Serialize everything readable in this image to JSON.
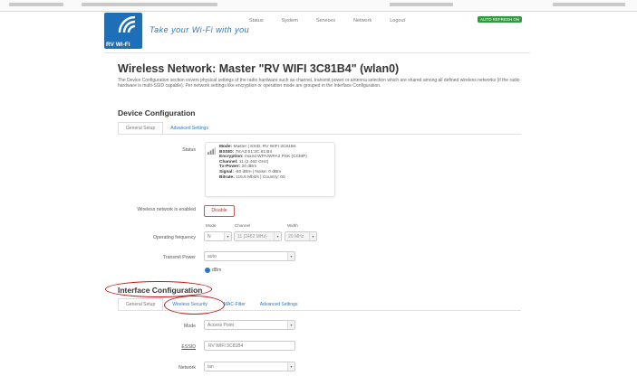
{
  "header": {
    "logo_text": "RV Wi-Fi",
    "tagline": "Take your Wi-Fi with you",
    "nav": [
      "Status",
      "System",
      "Services",
      "Network",
      "Logout"
    ],
    "auto_refresh": "AUTO REFRESH ON"
  },
  "page": {
    "title": "Wireless Network: Master \"RV WIFI 3C81B4\" (wlan0)",
    "description": "The Device Configuration section covers physical settings of the radio hardware such as channel, transmit power or antenna selection which are shared among all defined wireless networks (if the radio hardware is multi-SSID capable). Per network settings like encryption or operation mode are grouped in the Interface Configuration."
  },
  "device_config": {
    "heading": "Device Configuration",
    "tabs": [
      "General Setup",
      "Advanced Settings"
    ],
    "status_label": "Status",
    "status_lines": [
      {
        "k": "Mode:",
        "v": " Master | SSID: RV WIFI 3C81B4"
      },
      {
        "k": "BSSID:",
        "v": " 78:A3:51:3C:81:B4"
      },
      {
        "k": "Encryption:",
        "v": " mixed WPA/WPA2 PSK (CCMP)"
      },
      {
        "k": "Channel:",
        "v": " 11 (2.462 GHz)"
      },
      {
        "k": "Tx-Power:",
        "v": " 20 dBm"
      },
      {
        "k": "Signal:",
        "v": " -60 dBm | Noise: 0 dBm"
      },
      {
        "k": "Bitrate:",
        "v": " 115.6 Mbit/s | Country: 00"
      }
    ],
    "enabled_label": "Wireless network is enabled",
    "disable_button": "Disable",
    "op_freq_label": "Operating frequency",
    "mode_label": "Mode",
    "channel_label": "Channel",
    "width_label": "Width",
    "mode_value": "N",
    "channel_value": "11 (2462 MHz)",
    "width_value": "20 MHz",
    "tx_power_label": "Transmit Power",
    "tx_power_value": "auto",
    "dbm_text": "dBm"
  },
  "interface_config": {
    "heading": "Interface Configuration",
    "tabs": [
      "General Setup",
      "Wireless Security",
      "MAC-Filter",
      "Advanced Settings"
    ],
    "mode_label": "Mode",
    "mode_value": "Access Point",
    "essid_label": "ESSID",
    "essid_value": "RV WIFI 3C81B4",
    "network_label": "Network",
    "network_value": "lan"
  },
  "colors": {
    "accent": "#2a78c2",
    "annotation": "#c21a1a",
    "disable": "#c9302c",
    "refresh": "#2d9c3a"
  }
}
